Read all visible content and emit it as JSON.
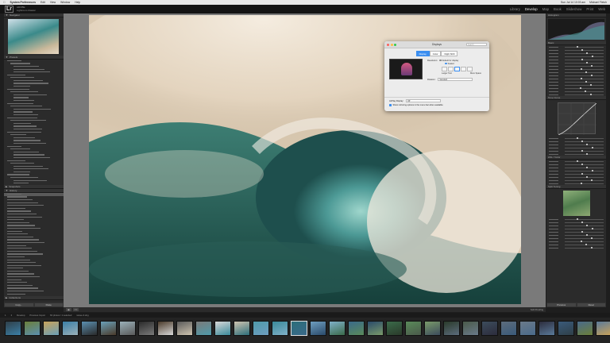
{
  "menubar": {
    "app": "System Preferences",
    "items": [
      "Edit",
      "View",
      "Window",
      "Help"
    ],
    "right": [
      "Sun Jul 14  10:03 am",
      "Michael Fletch"
    ]
  },
  "lr": {
    "logo": "Lr",
    "identity": [
      "ADOBE",
      "Lightroom Classic"
    ],
    "modules": [
      "Library",
      "Develop",
      "Map",
      "Book",
      "Slideshow",
      "Print",
      "Web"
    ],
    "active_module": "Develop"
  },
  "left_panel": {
    "navigator_title": "Navigator",
    "presets_title": "Presets",
    "snapshots_title": "Snapshots",
    "history_title": "History",
    "collections_title": "Collections",
    "copy_label": "Copy...",
    "paste_label": "Paste"
  },
  "right_panel": {
    "histogram_title": "Histogram",
    "basic_title": "Basic",
    "tone_curve_title": "Tone Curve",
    "hsl_title": "HSL / Color",
    "split_title": "Split Toning",
    "detail_title": "Detail",
    "previous_label": "Previous",
    "reset_label": "Reset"
  },
  "toolbar": {
    "soft_proofing": "Soft Proofing"
  },
  "filmstrip": {
    "header": [
      "1",
      "2",
      "Develop",
      "Previous Import",
      "63 photos / 1 selected",
      "/wave-3.dng"
    ]
  },
  "dialog": {
    "title": "Displays",
    "search_placeholder": "Search",
    "tabs": [
      "Display",
      "Color",
      "Night Shift"
    ],
    "active_tab": "Display",
    "resolution_label": "Resolution:",
    "resolution_options": [
      "Default for display",
      "Scaled"
    ],
    "resolution_selected": "Scaled",
    "rotation_label": "Rotation:",
    "rotation_value": "Standard",
    "more_space": "More Space",
    "larger_text": "Larger Text",
    "airplay_label": "AirPlay Display:",
    "airplay_value": "Off",
    "mirror_label": "Show mirroring options in the menu bar when available"
  },
  "colors": {
    "accent": "#3b8ef0",
    "panel_bg": "#2b2b2b",
    "canvas_bg": "#7a7a7a"
  }
}
